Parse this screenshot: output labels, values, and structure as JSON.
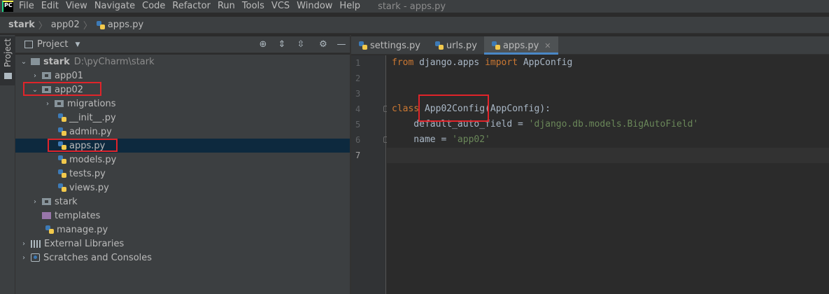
{
  "app": {
    "logo_text": "PC",
    "window_title": "stark - apps.py"
  },
  "menu": [
    "File",
    "Edit",
    "View",
    "Navigate",
    "Code",
    "Refactor",
    "Run",
    "Tools",
    "VCS",
    "Window",
    "Help"
  ],
  "breadcrumb": {
    "project": "stark",
    "folder": "app02",
    "file": "apps.py"
  },
  "tool_stripe": {
    "project_tab": "Project"
  },
  "project_panel": {
    "title": "Project"
  },
  "tree": [
    {
      "label": "stark",
      "path": "D:\\pyCharm\\stark"
    },
    {
      "label": "app01"
    },
    {
      "label": "app02"
    },
    {
      "label": "migrations"
    },
    {
      "label": "__init__.py"
    },
    {
      "label": "admin.py"
    },
    {
      "label": "apps.py"
    },
    {
      "label": "models.py"
    },
    {
      "label": "tests.py"
    },
    {
      "label": "views.py"
    },
    {
      "label": "stark"
    },
    {
      "label": "templates"
    },
    {
      "label": "manage.py"
    },
    {
      "label": "External Libraries"
    },
    {
      "label": "Scratches and Consoles"
    }
  ],
  "tabs": [
    {
      "label": "settings.py"
    },
    {
      "label": "urls.py"
    },
    {
      "label": "apps.py",
      "active": true
    }
  ],
  "editor": {
    "line_numbers": [
      "1",
      "2",
      "3",
      "4",
      "5",
      "6",
      "7"
    ],
    "current_line": "7",
    "code": {
      "l1_kw1": "from",
      "l1_mod": " django.apps ",
      "l1_kw2": "import",
      "l1_name": " AppConfig",
      "l4_kw": "class",
      "l4_name": " App02Config(AppConfig):",
      "l5_lhs": "    default_auto_field = ",
      "l5_str": "'django.db.models.BigAutoField'",
      "l6_lhs": "    name = ",
      "l6_str": "'app02'"
    }
  },
  "colors": {
    "highlight_box": "#e0242a",
    "selection": "#0d293e",
    "keyword": "#cc7832",
    "string": "#6a8759"
  }
}
